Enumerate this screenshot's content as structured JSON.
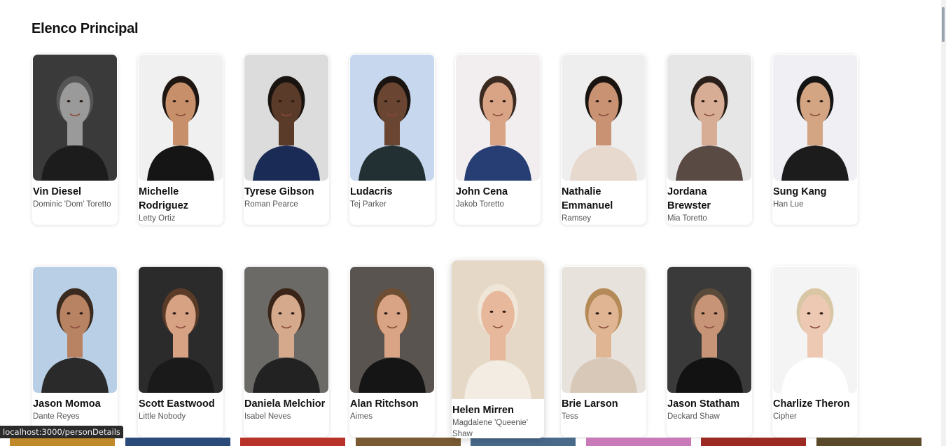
{
  "section": {
    "title": "Elenco Principal"
  },
  "cast_row_1": [
    {
      "name": "Vin Diesel",
      "character": "Dominic 'Dom' Toretto",
      "bg": "#3a3a3a",
      "skin": "#9a9a9a",
      "hair": "#555555",
      "shirt": "#1c1c1c"
    },
    {
      "name": "Michelle Rodriguez",
      "character": "Letty Ortiz",
      "bg": "#f0f0f0",
      "skin": "#c8906a",
      "hair": "#1e1612",
      "shirt": "#151515"
    },
    {
      "name": "Tyrese Gibson",
      "character": "Roman Pearce",
      "bg": "#dcdcdc",
      "skin": "#5a3a28",
      "hair": "#1a1410",
      "shirt": "#1a2c55"
    },
    {
      "name": "Ludacris",
      "character": "Tej Parker",
      "bg": "#c7d7ee",
      "skin": "#6a4632",
      "hair": "#1a1410",
      "shirt": "#233033"
    },
    {
      "name": "John Cena",
      "character": "Jakob Toretto",
      "bg": "#f2eef0",
      "skin": "#d9a486",
      "hair": "#3a2a20",
      "shirt": "#263e73"
    },
    {
      "name": "Nathalie Emmanuel",
      "character": "Ramsey",
      "bg": "#eeeeee",
      "skin": "#c99273",
      "hair": "#1a1410",
      "shirt": "#e8d9cf"
    },
    {
      "name": "Jordana Brewster",
      "character": "Mia Toretto",
      "bg": "#e6e6e6",
      "skin": "#d8ad95",
      "hair": "#2a1f19",
      "shirt": "#5a4a44"
    },
    {
      "name": "Sung Kang",
      "character": "Han Lue",
      "bg": "#f0f0f4",
      "skin": "#d4a583",
      "hair": "#141414",
      "shirt": "#1c1c1c"
    }
  ],
  "cast_row_2": [
    {
      "name": "Jason Momoa",
      "character": "Dante Reyes",
      "bg": "#b9cfe6",
      "skin": "#b88363",
      "hair": "#3a2a20",
      "shirt": "#2a2a2a"
    },
    {
      "name": "Scott Eastwood",
      "character": "Little Nobody",
      "bg": "#2b2b2b",
      "skin": "#d6a283",
      "hair": "#5a3b28",
      "shirt": "#1a1a1a"
    },
    {
      "name": "Daniela Melchior",
      "character": "Isabel Neves",
      "bg": "#6c6a66",
      "skin": "#d4a98c",
      "hair": "#3a2418",
      "shirt": "#222222"
    },
    {
      "name": "Alan Ritchson",
      "character": "Aimes",
      "bg": "#5a5450",
      "skin": "#d9a486",
      "hair": "#6e4e32",
      "shirt": "#151515"
    },
    {
      "name": "Helen Mirren",
      "character": "Magdalene 'Queenie' Shaw",
      "bg": "#e6d8c6",
      "skin": "#e8b89c",
      "hair": "#efe6d8",
      "shirt": "#f2ece2"
    },
    {
      "name": "Brie Larson",
      "character": "Tess",
      "bg": "#e8e2dc",
      "skin": "#e0b594",
      "hair": "#b48a58",
      "shirt": "#d8c8b8"
    },
    {
      "name": "Jason Statham",
      "character": "Deckard Shaw",
      "bg": "#3a3a3a",
      "skin": "#c89478",
      "hair": "#5a4a3a",
      "shirt": "#121212"
    },
    {
      "name": "Charlize Theron",
      "character": "Cipher",
      "bg": "#f4f4f4",
      "skin": "#edc9b3",
      "hair": "#d8c6a4",
      "shirt": "#ffffff"
    }
  ],
  "status_bar": {
    "url": "localhost:3000/personDetails"
  },
  "thumb_strip": [
    {
      "color": "#c08a2a"
    },
    {
      "color": "#2a4a7a"
    },
    {
      "color": "#b8322a"
    },
    {
      "color": "#7a5a32"
    },
    {
      "color": "#4a6a8a"
    },
    {
      "color": "#c87ab8"
    },
    {
      "color": "#9a2a22"
    },
    {
      "color": "#5a4a2a"
    }
  ]
}
